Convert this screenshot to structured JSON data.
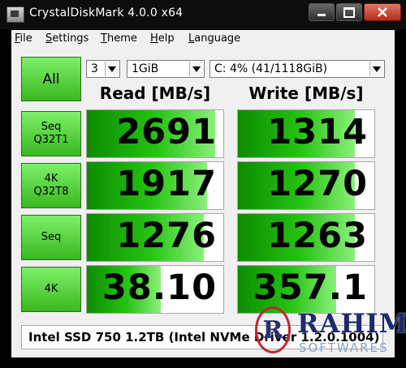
{
  "window": {
    "title": "CrystalDiskMark 4.0.0 x64"
  },
  "menu": [
    {
      "label": "File",
      "u": "F",
      "rest": "ile"
    },
    {
      "label": "Settings",
      "u": "S",
      "rest": "ettings"
    },
    {
      "label": "Theme",
      "u": "T",
      "rest": "heme"
    },
    {
      "label": "Help",
      "u": "H",
      "rest": "elp"
    },
    {
      "label": "Language",
      "u": "L",
      "rest": "anguage"
    }
  ],
  "controls": {
    "all_label": "All",
    "count": "3",
    "size": "1GiB",
    "drive": "C: 4% (41/1118GiB)"
  },
  "headers": {
    "read": "Read [MB/s]",
    "write": "Write [MB/s]"
  },
  "tests": [
    {
      "line1": "Seq",
      "line2": "Q32T1",
      "read": "2691",
      "write": "1314",
      "read_fill": 0.94,
      "write_fill": 0.86
    },
    {
      "line1": "4K",
      "line2": "Q32T8",
      "read": "1917",
      "write": "1270",
      "read_fill": 0.88,
      "write_fill": 0.86
    },
    {
      "line1": "Seq",
      "line2": "",
      "read": "1276",
      "write": "1263",
      "read_fill": 0.86,
      "write_fill": 0.86
    },
    {
      "line1": "4K",
      "line2": "",
      "read": "38.10",
      "write": "357.1",
      "read_fill": 0.54,
      "write_fill": 0.72
    }
  ],
  "comment": "Intel SSD 750 1.2TB (Intel NVMe Driver 1.2.0.1004)",
  "watermark": {
    "name": "RAHIM",
    "sub": "SOFTWARES",
    "letter": "R"
  }
}
